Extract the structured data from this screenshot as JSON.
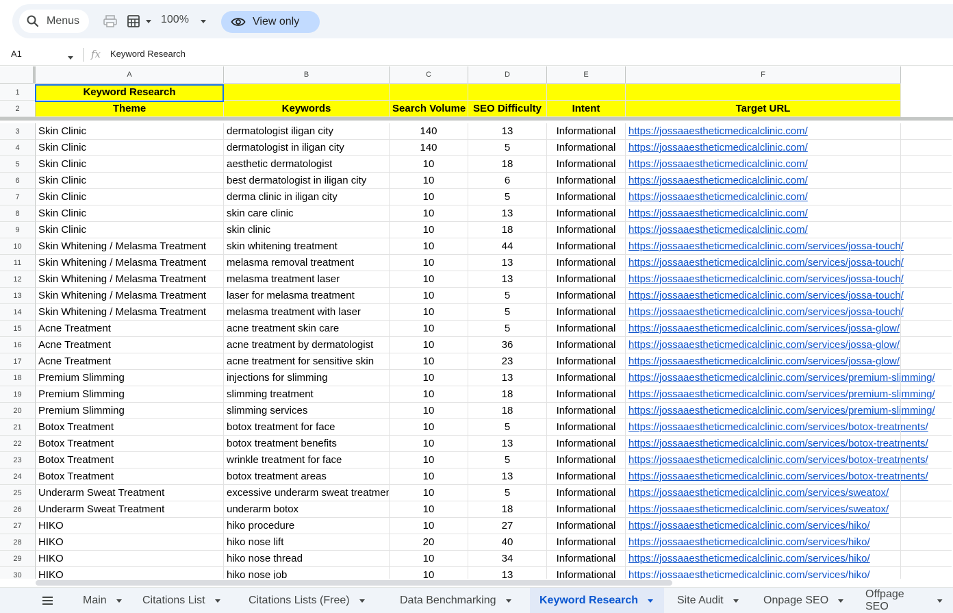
{
  "toolbar": {
    "menus_label": "Menus",
    "zoom": "100%",
    "view_label": "View only"
  },
  "formula_bar": {
    "cell_ref": "A1",
    "formula": "Keyword Research"
  },
  "columns": [
    "A",
    "B",
    "C",
    "D",
    "E",
    "F"
  ],
  "header_row": {
    "title": "Keyword Research",
    "labels": [
      "Theme",
      "Keywords",
      "Search Volume",
      "SEO Difficulty",
      "Intent",
      "Target URL"
    ]
  },
  "rows": [
    {
      "n": "3",
      "theme": "Skin Clinic",
      "keyword": "dermatologist iligan city",
      "volume": "140",
      "difficulty": "13",
      "intent": "Informational",
      "url": "https://jossaaestheticmedicalclinic.com/"
    },
    {
      "n": "4",
      "theme": "Skin Clinic",
      "keyword": "dermatologist in iligan city",
      "volume": "140",
      "difficulty": "5",
      "intent": "Informational",
      "url": "https://jossaaestheticmedicalclinic.com/"
    },
    {
      "n": "5",
      "theme": "Skin Clinic",
      "keyword": "aesthetic dermatologist",
      "volume": "10",
      "difficulty": "18",
      "intent": "Informational",
      "url": "https://jossaaestheticmedicalclinic.com/"
    },
    {
      "n": "6",
      "theme": "Skin Clinic",
      "keyword": "best dermatologist in iligan city",
      "volume": "10",
      "difficulty": "6",
      "intent": "Informational",
      "url": "https://jossaaestheticmedicalclinic.com/"
    },
    {
      "n": "7",
      "theme": "Skin Clinic",
      "keyword": "derma clinic in iligan city",
      "volume": "10",
      "difficulty": "5",
      "intent": "Informational",
      "url": "https://jossaaestheticmedicalclinic.com/"
    },
    {
      "n": "8",
      "theme": "Skin Clinic",
      "keyword": "skin care clinic",
      "volume": "10",
      "difficulty": "13",
      "intent": "Informational",
      "url": "https://jossaaestheticmedicalclinic.com/"
    },
    {
      "n": "9",
      "theme": "Skin Clinic",
      "keyword": "skin clinic",
      "volume": "10",
      "difficulty": "18",
      "intent": "Informational",
      "url": "https://jossaaestheticmedicalclinic.com/"
    },
    {
      "n": "10",
      "theme": "Skin Whitening / Melasma Treatment",
      "keyword": "skin whitening treatment",
      "volume": "10",
      "difficulty": "44",
      "intent": "Informational",
      "url": "https://jossaaestheticmedicalclinic.com/services/jossa-touch/"
    },
    {
      "n": "11",
      "theme": "Skin Whitening / Melasma Treatment",
      "keyword": "melasma removal treatment",
      "volume": "10",
      "difficulty": "13",
      "intent": "Informational",
      "url": "https://jossaaestheticmedicalclinic.com/services/jossa-touch/"
    },
    {
      "n": "12",
      "theme": "Skin Whitening / Melasma Treatment",
      "keyword": "melasma treatment laser",
      "volume": "10",
      "difficulty": "13",
      "intent": "Informational",
      "url": "https://jossaaestheticmedicalclinic.com/services/jossa-touch/"
    },
    {
      "n": "13",
      "theme": "Skin Whitening / Melasma Treatment",
      "keyword": "laser for melasma treatment",
      "volume": "10",
      "difficulty": "5",
      "intent": "Informational",
      "url": "https://jossaaestheticmedicalclinic.com/services/jossa-touch/"
    },
    {
      "n": "14",
      "theme": "Skin Whitening / Melasma Treatment",
      "keyword": "melasma treatment with laser",
      "volume": "10",
      "difficulty": "5",
      "intent": "Informational",
      "url": "https://jossaaestheticmedicalclinic.com/services/jossa-touch/"
    },
    {
      "n": "15",
      "theme": "Acne Treatment",
      "keyword": "acne treatment skin care",
      "volume": "10",
      "difficulty": "5",
      "intent": "Informational",
      "url": "https://jossaaestheticmedicalclinic.com/services/jossa-glow/"
    },
    {
      "n": "16",
      "theme": "Acne Treatment",
      "keyword": "acne treatment by dermatologist",
      "volume": "10",
      "difficulty": "36",
      "intent": "Informational",
      "url": "https://jossaaestheticmedicalclinic.com/services/jossa-glow/"
    },
    {
      "n": "17",
      "theme": "Acne Treatment",
      "keyword": "acne treatment for sensitive skin",
      "volume": "10",
      "difficulty": "23",
      "intent": "Informational",
      "url": "https://jossaaestheticmedicalclinic.com/services/jossa-glow/"
    },
    {
      "n": "18",
      "theme": "Premium Slimming",
      "keyword": "injections for slimming",
      "volume": "10",
      "difficulty": "13",
      "intent": "Informational",
      "url": "https://jossaaestheticmedicalclinic.com/services/premium-slimming/"
    },
    {
      "n": "19",
      "theme": "Premium Slimming",
      "keyword": "slimming treatment",
      "volume": "10",
      "difficulty": "18",
      "intent": "Informational",
      "url": "https://jossaaestheticmedicalclinic.com/services/premium-slimming/"
    },
    {
      "n": "20",
      "theme": "Premium Slimming",
      "keyword": "slimming services",
      "volume": "10",
      "difficulty": "18",
      "intent": "Informational",
      "url": "https://jossaaestheticmedicalclinic.com/services/premium-slimming/"
    },
    {
      "n": "21",
      "theme": "Botox Treatment",
      "keyword": "botox treatment for face",
      "volume": "10",
      "difficulty": "5",
      "intent": "Informational",
      "url": "https://jossaaestheticmedicalclinic.com/services/botox-treatments/"
    },
    {
      "n": "22",
      "theme": "Botox Treatment",
      "keyword": "botox treatment benefits",
      "volume": "10",
      "difficulty": "13",
      "intent": "Informational",
      "url": "https://jossaaestheticmedicalclinic.com/services/botox-treatments/"
    },
    {
      "n": "23",
      "theme": "Botox Treatment",
      "keyword": "wrinkle treatment for face",
      "volume": "10",
      "difficulty": "5",
      "intent": "Informational",
      "url": "https://jossaaestheticmedicalclinic.com/services/botox-treatments/"
    },
    {
      "n": "24",
      "theme": "Botox Treatment",
      "keyword": "botox treatment areas",
      "volume": "10",
      "difficulty": "13",
      "intent": "Informational",
      "url": "https://jossaaestheticmedicalclinic.com/services/botox-treatments/"
    },
    {
      "n": "25",
      "theme": "Underarm Sweat Treatment",
      "keyword": "excessive underarm sweat treatmen",
      "volume": "10",
      "difficulty": "5",
      "intent": "Informational",
      "url": "https://jossaaestheticmedicalclinic.com/services/sweatox/"
    },
    {
      "n": "26",
      "theme": "Underarm Sweat Treatment",
      "keyword": "underarm botox",
      "volume": "10",
      "difficulty": "18",
      "intent": "Informational",
      "url": "https://jossaaestheticmedicalclinic.com/services/sweatox/"
    },
    {
      "n": "27",
      "theme": "HIKO",
      "keyword": "hiko procedure",
      "volume": "10",
      "difficulty": "27",
      "intent": "Informational",
      "url": "https://jossaaestheticmedicalclinic.com/services/hiko/"
    },
    {
      "n": "28",
      "theme": "HIKO",
      "keyword": "hiko nose lift",
      "volume": "20",
      "difficulty": "40",
      "intent": "Informational",
      "url": "https://jossaaestheticmedicalclinic.com/services/hiko/"
    },
    {
      "n": "29",
      "theme": "HIKO",
      "keyword": "hiko nose thread",
      "volume": "10",
      "difficulty": "34",
      "intent": "Informational",
      "url": "https://jossaaestheticmedicalclinic.com/services/hiko/"
    },
    {
      "n": "30",
      "theme": "HIKO",
      "keyword": "hiko nose job",
      "volume": "10",
      "difficulty": "13",
      "intent": "Informational",
      "url": "https://jossaaestheticmedicalclinic.com/services/hiko/"
    }
  ],
  "tabs": [
    {
      "label": "Main",
      "active": false
    },
    {
      "label": "Citations List",
      "active": false
    },
    {
      "label": "Citations Lists (Free)",
      "active": false
    },
    {
      "label": "Data Benchmarking",
      "active": false
    },
    {
      "label": "Keyword Research",
      "active": true
    },
    {
      "label": "Site Audit",
      "active": false
    },
    {
      "label": "Onpage SEO",
      "active": false
    },
    {
      "label": "Offpage SEO",
      "active": false
    }
  ],
  "colors": {
    "header_fill": "#ffff00",
    "link": "#1155cc",
    "selection": "#1a73e8",
    "view_pill": "#c2dbff"
  }
}
